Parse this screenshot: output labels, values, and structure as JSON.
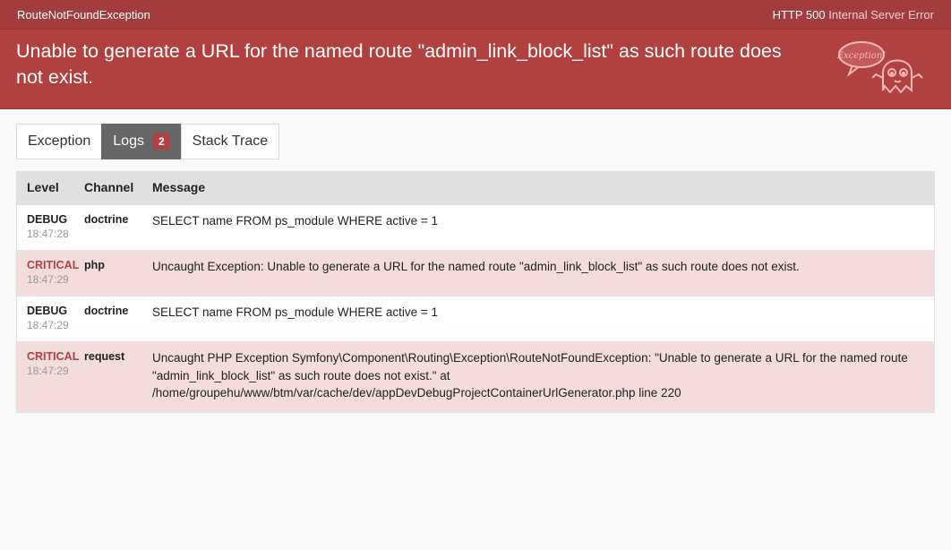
{
  "topbar": {
    "exception_class": "RouteNotFoundException",
    "status_code": "HTTP 500",
    "status_text": "Internal Server Error"
  },
  "header": {
    "message": "Unable to generate a URL for the named route \"admin_link_block_list\" as such route does not exist.",
    "ghost_label": "Exception!"
  },
  "tabs": [
    {
      "label": "Exception"
    },
    {
      "label": "Logs",
      "badge": "2",
      "active": true
    },
    {
      "label": "Stack Trace"
    }
  ],
  "logs": {
    "columns": [
      "Level",
      "Channel",
      "Message"
    ],
    "entries": [
      {
        "level": "DEBUG",
        "time": "18:47:28",
        "channel": "doctrine",
        "message": "SELECT name FROM ps_module WHERE active = 1",
        "critical": false
      },
      {
        "level": "CRITICAL",
        "time": "18:47:29",
        "channel": "php",
        "message": "Uncaught Exception: Unable to generate a URL for the named route \"admin_link_block_list\" as such route does not exist.",
        "critical": true
      },
      {
        "level": "DEBUG",
        "time": "18:47:29",
        "channel": "doctrine",
        "message": "SELECT name FROM ps_module WHERE active = 1",
        "critical": false
      },
      {
        "level": "CRITICAL",
        "time": "18:47:29",
        "channel": "request",
        "message": "Uncaught PHP Exception Symfony\\Component\\Routing\\Exception\\RouteNotFoundException: \"Unable to generate a URL for the named route \"admin_link_block_list\" as such route does not exist.\" at /home/groupehu/www/btm/var/cache/dev/appDevDebugProjectContainerUrlGenerator.php line 220",
        "critical": true
      }
    ]
  },
  "colors": {
    "brand_red": "#b0413e",
    "topbar_red": "#a33d3d",
    "critical_row": "#f2dcdc",
    "active_tab": "#666666"
  }
}
